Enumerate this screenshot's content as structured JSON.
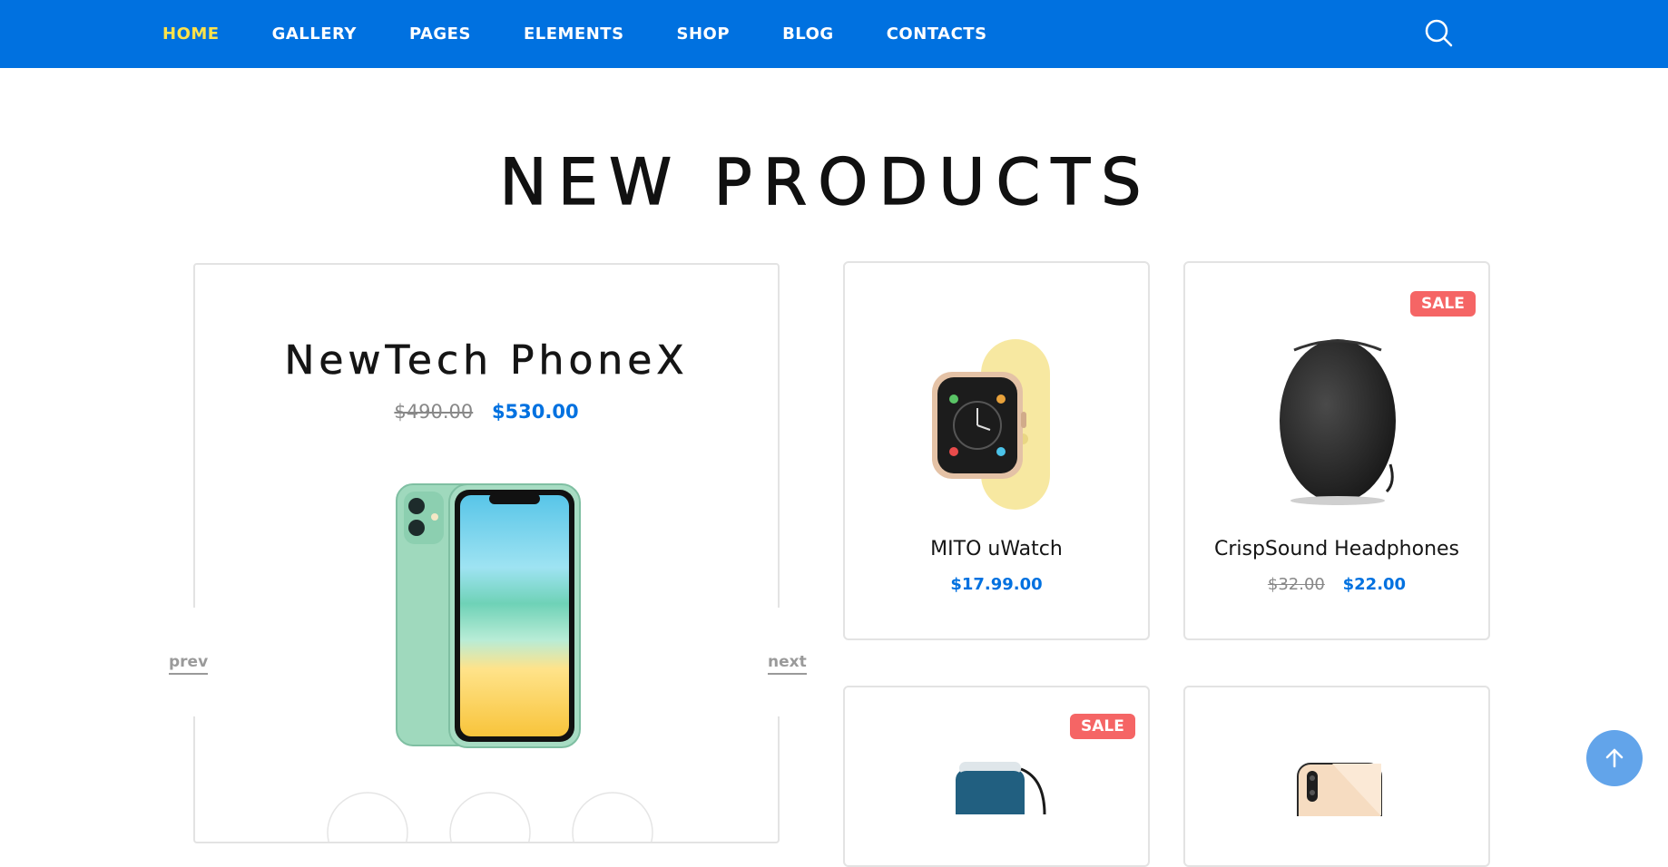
{
  "nav": {
    "items": [
      {
        "label": "HOME",
        "active": true
      },
      {
        "label": "GALLERY",
        "active": false
      },
      {
        "label": "PAGES",
        "active": false
      },
      {
        "label": "ELEMENTS",
        "active": false
      },
      {
        "label": "SHOP",
        "active": false
      },
      {
        "label": "BLOG",
        "active": false
      },
      {
        "label": "CONTACTS",
        "active": false
      }
    ],
    "search_icon": "search-icon",
    "active_color": "#ffe24b",
    "bar_color": "#0071e0"
  },
  "section": {
    "title": "NEW PRODUCTS"
  },
  "featured": {
    "name": "NewTech PhoneX",
    "old_price": "$490.00",
    "price": "$530.00",
    "prev_label": "prev",
    "next_label": "next"
  },
  "products": [
    {
      "name": "MITO uWatch",
      "old_price": "",
      "price": "$17.99.00",
      "badge": ""
    },
    {
      "name": "CrispSound Headphones",
      "old_price": "$32.00",
      "price": "$22.00",
      "badge": "SALE"
    },
    {
      "name": "",
      "old_price": "",
      "price": "",
      "badge": "SALE"
    },
    {
      "name": "",
      "old_price": "",
      "price": "",
      "badge": ""
    }
  ],
  "scroll_top_icon": "arrow-up-icon",
  "accent_color": "#0071e0",
  "sale_color": "#f56565"
}
